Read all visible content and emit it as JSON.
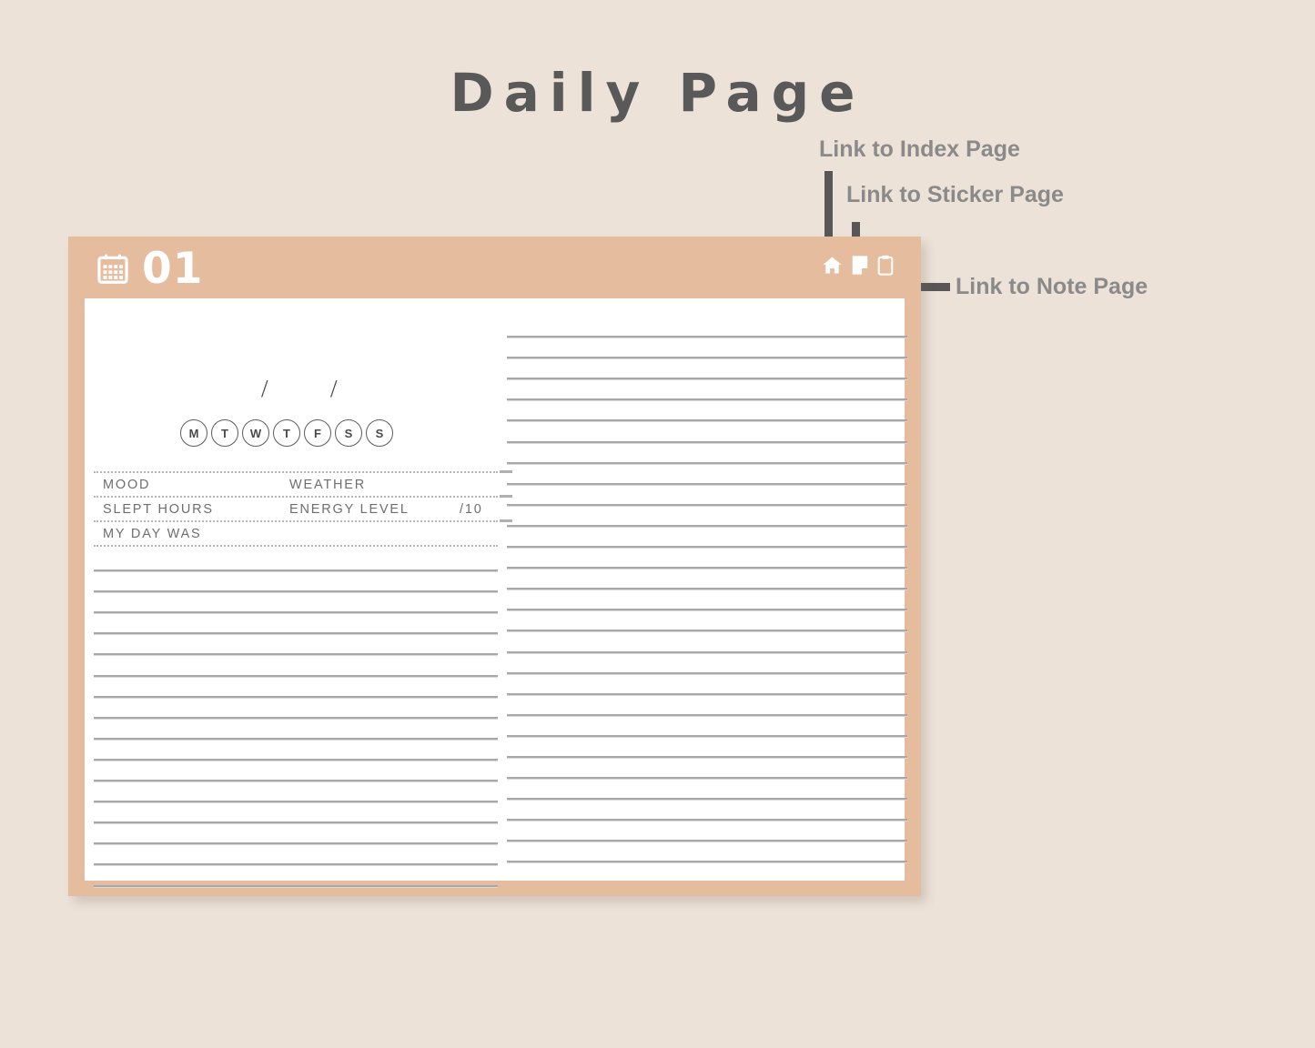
{
  "title": "Daily Page",
  "theme": {
    "background": "#ece2d8",
    "accent": "#e5bc9e",
    "paper": "#ffffff",
    "text_gray": "#8a8a8a",
    "title_gray": "#595959",
    "rule_gray": "#a8a8a8"
  },
  "annotations": [
    {
      "id": "index",
      "label": "Link to Index Page"
    },
    {
      "id": "sticker",
      "label": "Link to Sticker Page"
    },
    {
      "id": "note",
      "label": "Link to Note Page"
    }
  ],
  "planner": {
    "header": {
      "calendar_icon": "calendar-icon",
      "day_number": "01",
      "icons": [
        {
          "name": "home-icon",
          "target": "Index Page"
        },
        {
          "name": "sticky-note-icon",
          "target": "Sticker Page"
        },
        {
          "name": "clipboard-icon",
          "target": "Note Page"
        }
      ]
    },
    "date_field": {
      "separator_1": "/",
      "separator_2": "/"
    },
    "weekdays": [
      "M",
      "T",
      "W",
      "T",
      "F",
      "S",
      "S"
    ],
    "meta_rows": [
      {
        "col1": "MOOD",
        "col2": "WEATHER",
        "col3": ""
      },
      {
        "col1": "SLEPT HOURS",
        "col2": "ENERGY LEVEL",
        "col3": "/10"
      },
      {
        "col1": "MY DAY WAS",
        "col2": "",
        "col3": ""
      }
    ],
    "left_column_lines": 16,
    "right_column_lines": 26
  }
}
